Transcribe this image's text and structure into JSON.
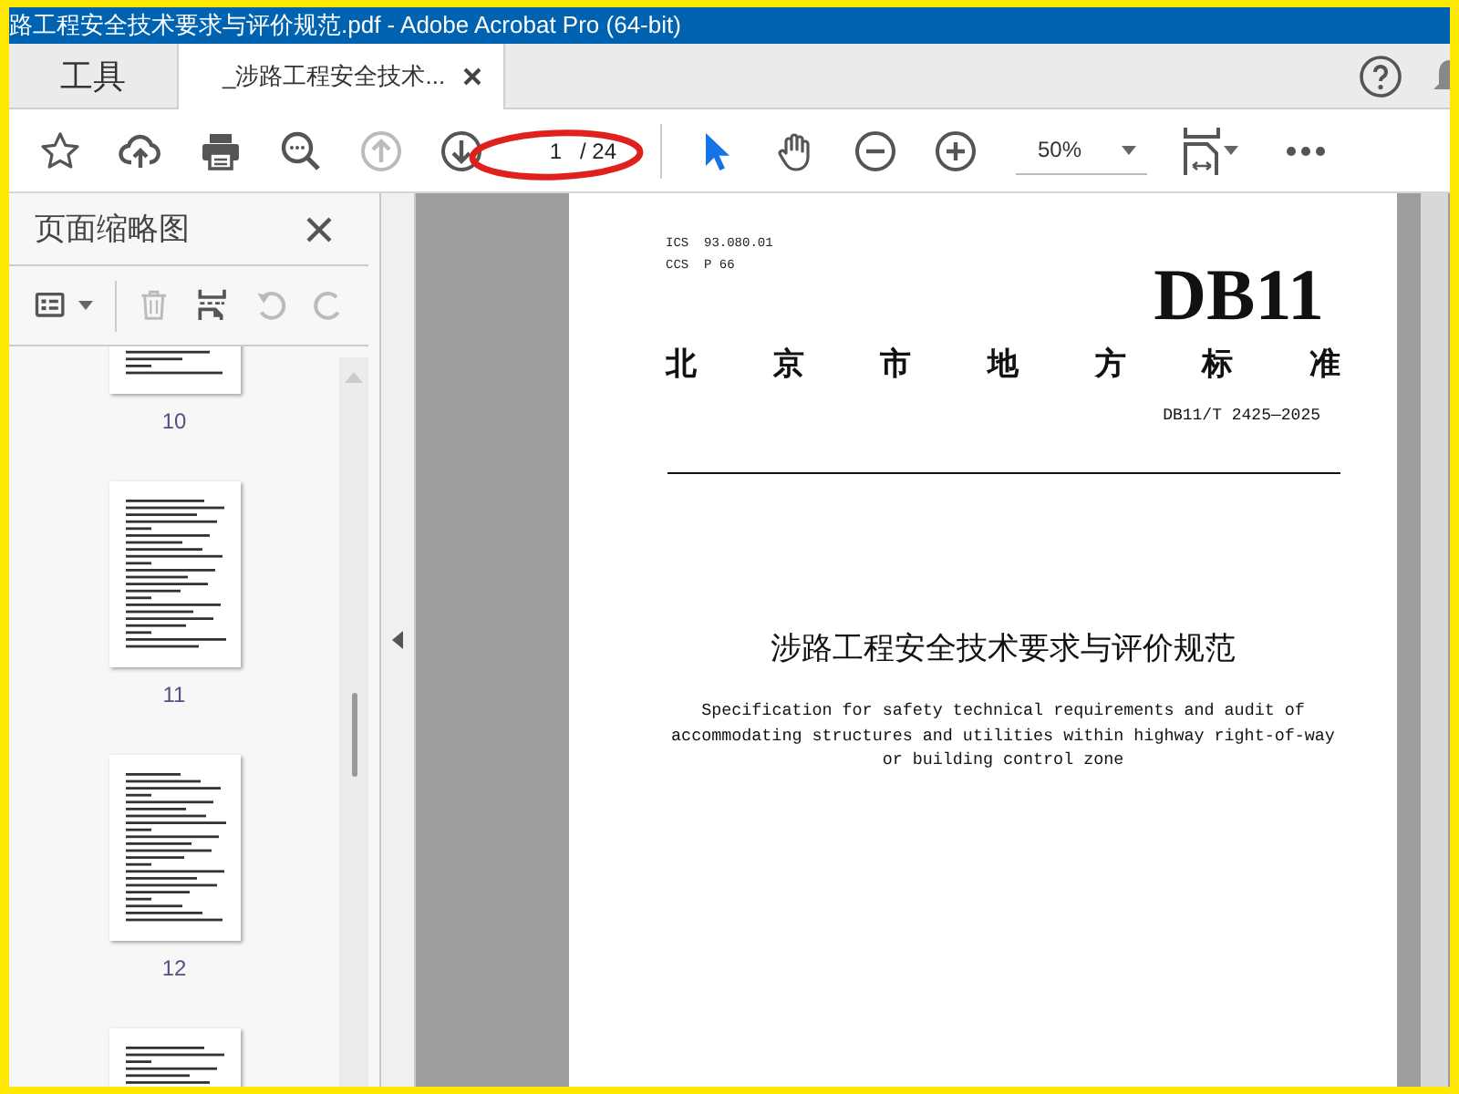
{
  "window": {
    "title": "路工程安全技术要求与评价规范.pdf - Adobe Acrobat Pro (64-bit)"
  },
  "tabs": [
    {
      "label": "工具",
      "selected": false,
      "closable": false
    },
    {
      "label": "_涉路工程安全技术...",
      "selected": true,
      "closable": true
    }
  ],
  "toolbar": {
    "buttons": [
      {
        "kind": "star",
        "disabled": false
      },
      {
        "kind": "upload",
        "disabled": false
      },
      {
        "kind": "print",
        "disabled": false
      },
      {
        "kind": "search",
        "disabled": false
      },
      {
        "kind": "page-up",
        "disabled": true
      },
      {
        "kind": "page-down",
        "disabled": false
      }
    ],
    "page_field": {
      "value": "1",
      "total": "/ 24"
    },
    "annotation": {
      "kind": "ellipse"
    },
    "tools": [
      {
        "kind": "pointer",
        "selected": true
      },
      {
        "kind": "hand",
        "selected": false
      },
      {
        "kind": "zoom-out",
        "selected": false
      },
      {
        "kind": "zoom-in",
        "selected": false
      }
    ],
    "zoom": {
      "value": "50%"
    }
  },
  "sidebar": {
    "title": "页面缩略图",
    "tools": [
      {
        "kind": "options",
        "disabled": false
      },
      {
        "kind": "delete",
        "disabled": true
      },
      {
        "kind": "insert",
        "disabled": false
      },
      {
        "kind": "undo",
        "disabled": true
      },
      {
        "kind": "redo",
        "disabled": true
      }
    ],
    "thumbnails": [
      {
        "label": "10",
        "selected": false
      },
      {
        "label": "11",
        "selected": false
      },
      {
        "label": "12",
        "selected": false
      },
      {
        "selected": false
      }
    ]
  },
  "document": {
    "ics": "ICS  93.080.01",
    "ccs": "CCS  P 66",
    "code": "DB11",
    "issuer": "北京市地方标准",
    "number": "DB11/T 2425—2025",
    "title": "涉路工程安全技术要求与评价规范",
    "subtitle_lines": [
      "Specification for safety technical requirements and audit of",
      "accommodating structures and utilities within highway right-of-way",
      "or building control zone"
    ]
  }
}
